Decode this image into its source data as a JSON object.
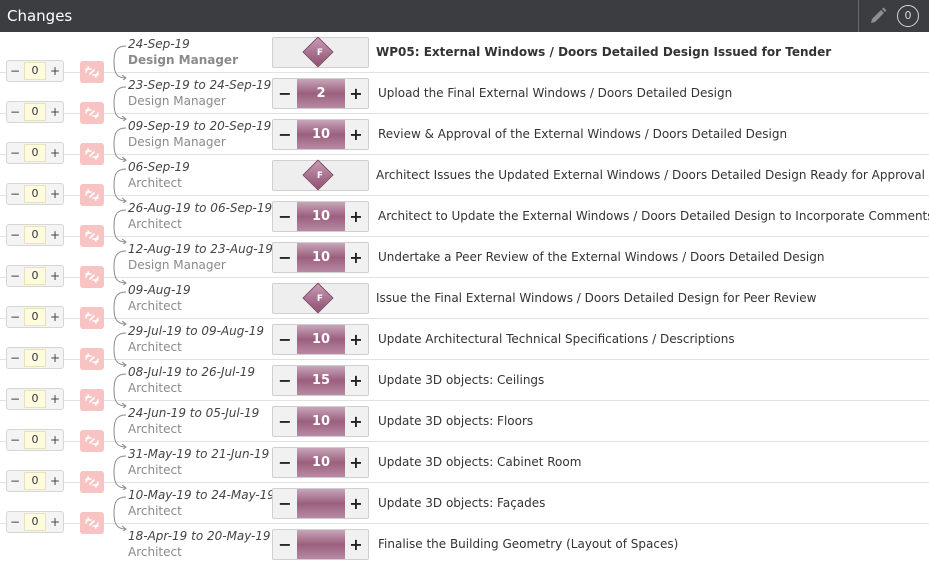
{
  "header": {
    "title": "Changes",
    "counter": "0",
    "edit_icon": "pencil-icon"
  },
  "rows": [
    {
      "type": "milestone",
      "stepper": "0",
      "date": "24-Sep-19",
      "role": "Design Manager",
      "ms_label": "F",
      "task": "WP05: External Windows / Doors Detailed Design Issued for Tender",
      "bold": true
    },
    {
      "type": "duration",
      "stepper": "0",
      "date": "23-Sep-19 to 24-Sep-19",
      "role": "Design Manager",
      "duration": "2",
      "task": "Upload the Final External Windows / Doors Detailed Design"
    },
    {
      "type": "duration",
      "stepper": "0",
      "date": "09-Sep-19 to 20-Sep-19",
      "role": "Design Manager",
      "duration": "10",
      "task": "Review & Approval of the External Windows / Doors Detailed Design"
    },
    {
      "type": "milestone",
      "stepper": "0",
      "date": "06-Sep-19",
      "role": "Architect",
      "ms_label": "F",
      "task": "Architect Issues the Updated External Windows / Doors Detailed Design Ready for Approval"
    },
    {
      "type": "duration",
      "stepper": "0",
      "date": "26-Aug-19 to 06-Sep-19",
      "role": "Architect",
      "duration": "10",
      "task": "Architect to Update the External Windows / Doors Detailed Design to Incorporate Comments"
    },
    {
      "type": "duration",
      "stepper": "0",
      "date": "12-Aug-19 to 23-Aug-19",
      "role": "Design Manager",
      "duration": "10",
      "task": "Undertake a Peer Review of the External Windows / Doors Detailed Design"
    },
    {
      "type": "milestone",
      "stepper": "0",
      "date": "09-Aug-19",
      "role": "Architect",
      "ms_label": "F",
      "task": "Issue the Final External Windows / Doors Detailed Design for Peer Review"
    },
    {
      "type": "duration",
      "stepper": "0",
      "date": "29-Jul-19 to 09-Aug-19",
      "role": "Architect",
      "duration": "10",
      "task": "Update Architectural Technical Specifications / Descriptions"
    },
    {
      "type": "duration",
      "stepper": "0",
      "date": "08-Jul-19 to 26-Jul-19",
      "role": "Architect",
      "duration": "15",
      "task": "Update 3D objects: Ceilings"
    },
    {
      "type": "duration",
      "stepper": "0",
      "date": "24-Jun-19 to 05-Jul-19",
      "role": "Architect",
      "duration": "10",
      "task": "Update 3D objects: Floors"
    },
    {
      "type": "duration",
      "stepper": "0",
      "date": "31-May-19 to 21-Jun-19",
      "role": "Architect",
      "duration": "10",
      "task": "Update 3D objects: Cabinet Room"
    },
    {
      "type": "duration",
      "stepper": "0",
      "date": "10-May-19 to 24-May-19",
      "role": "Architect",
      "duration": "",
      "task": "Update 3D objects: Façades"
    },
    {
      "type": "duration",
      "stepper": null,
      "date": "18-Apr-19 to 20-May-19",
      "role": "Architect",
      "duration": "",
      "task": "Finalise the Building Geometry (Layout of Spaces)"
    }
  ],
  "controls": {
    "minus": "−",
    "plus": "+"
  }
}
